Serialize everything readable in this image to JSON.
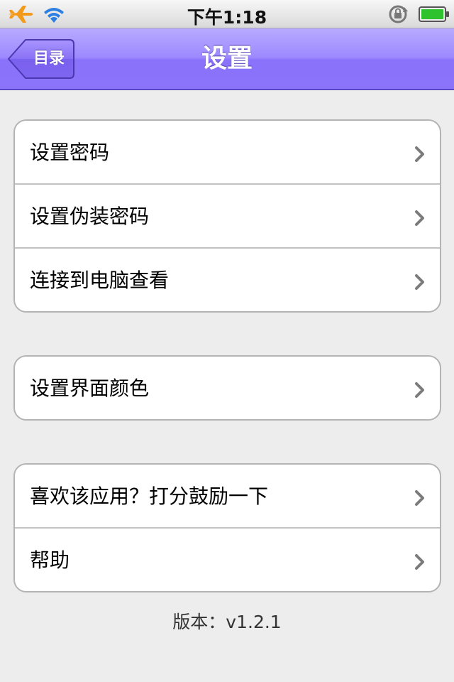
{
  "status_bar": {
    "time": "下午1:18",
    "icons": [
      "airplane-icon",
      "wifi-icon",
      "orientation-lock-icon",
      "battery-icon"
    ]
  },
  "nav_bar": {
    "back_label": "目录",
    "title": "设置"
  },
  "groups": [
    {
      "rows": [
        {
          "label": "设置密码"
        },
        {
          "label": "设置伪装密码"
        },
        {
          "label": "连接到电脑查看"
        }
      ]
    },
    {
      "rows": [
        {
          "label": "设置界面颜色"
        }
      ]
    },
    {
      "rows": [
        {
          "label": "喜欢该应用？打分鼓励一下"
        },
        {
          "label": "帮助"
        }
      ]
    }
  ],
  "version": "版本：v1.2.1",
  "colors": {
    "nav_bar": "#9d89ff",
    "background": "#ededed",
    "airplane": "#f39a1a",
    "wifi": "#2b7fe0",
    "battery": "#2ec32e"
  }
}
